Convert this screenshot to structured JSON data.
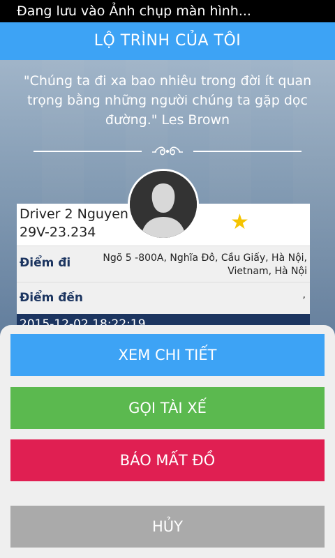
{
  "statusbar": {
    "text": "Đang lưu vào Ảnh chụp màn hình..."
  },
  "header": {
    "title": "LỘ TRÌNH CỦA TÔI"
  },
  "quote": {
    "text": "\"Chúng ta đi xa bao nhiêu trong đời ít quan trọng bằng những người chúng ta gặp dọc đường.\" Les Brown"
  },
  "trip": {
    "driver_name": "Driver 2 Nguyen",
    "plate": "29V-23.234",
    "rating_icon": "star-icon",
    "origin_label": "Điểm đi",
    "origin_address": "Ngõ 5 -800A, Nghĩa Đô, Cầu Giấy, Hà Nội, Vietnam, Hà Nội",
    "destination_label": "Điểm đến",
    "destination_address": ",",
    "datetime": "2015-12-02 18:22:19"
  },
  "actions": {
    "detail": "XEM CHI TIẾT",
    "call": "GỌI TÀI XẾ",
    "lost": "BÁO MẤT ĐỒ",
    "cancel": "HỦY"
  },
  "colors": {
    "header": "#3da3f5",
    "detail": "#3da3f5",
    "call": "#5bb94f",
    "lost": "#e01f52",
    "cancel": "#aaaaaa",
    "star": "#f5c400",
    "label": "#1c3560"
  }
}
